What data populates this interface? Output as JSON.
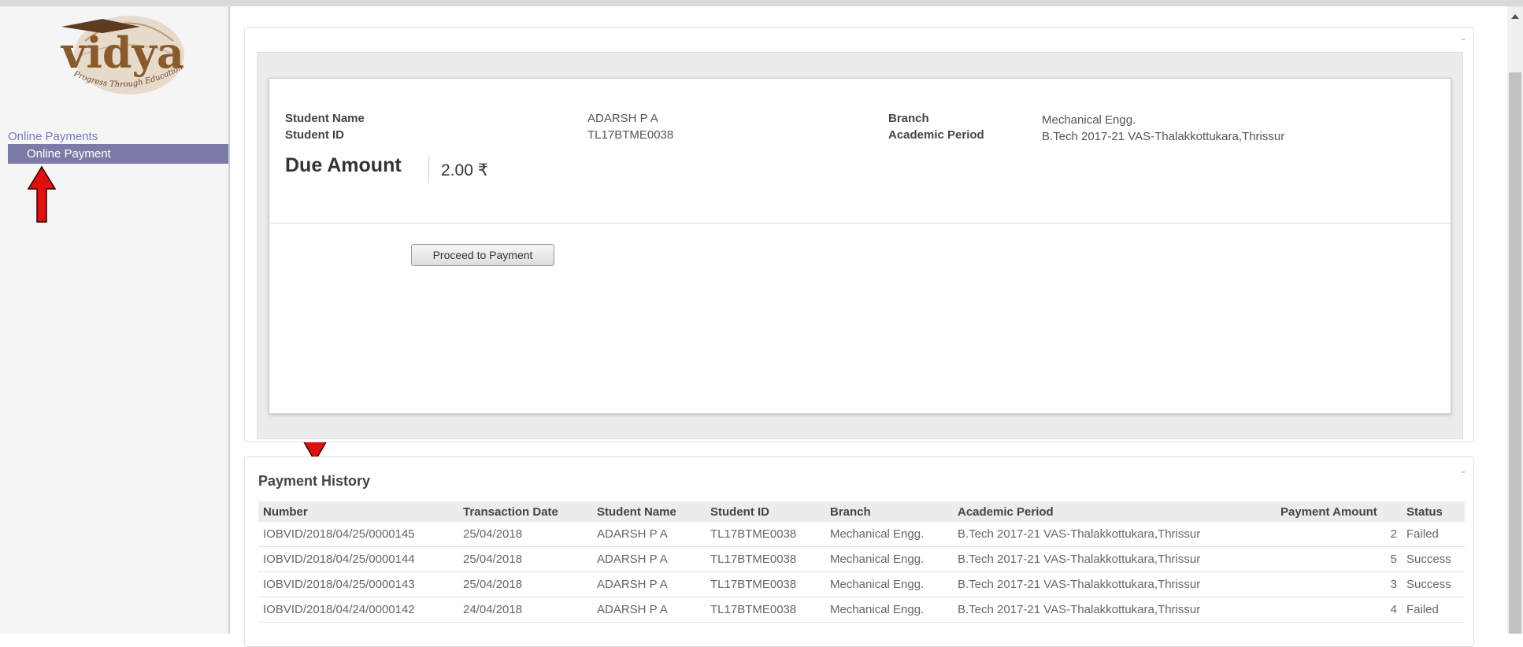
{
  "sidebar": {
    "logo_text": "vidya",
    "logo_tagline": "Progress Through Education",
    "menu_title": "Online Payments",
    "menu_item": "Online Payment"
  },
  "payment_card": {
    "labels": {
      "student_name": "Student Name",
      "student_id": "Student ID",
      "branch": "Branch",
      "academic_period": "Academic Period",
      "due_amount": "Due Amount"
    },
    "values": {
      "student_name": "ADARSH P A",
      "student_id": "TL17BTME0038",
      "branch": "Mechanical Engg.",
      "academic_period": "B.Tech 2017-21 VAS-Thalakkottukara,Thrissur",
      "due_amount": "2.00 ₹"
    },
    "proceed_button": "Proceed to Payment",
    "collapse_symbol": "-"
  },
  "payment_history": {
    "title": "Payment History",
    "collapse_symbol": "-",
    "columns": [
      "Number",
      "Transaction Date",
      "Student Name",
      "Student ID",
      "Branch",
      "Academic Period",
      "Payment Amount",
      "Status"
    ],
    "rows": [
      [
        "IOBVID/2018/04/25/0000145",
        "25/04/2018",
        "ADARSH P A",
        "TL17BTME0038",
        "Mechanical Engg.",
        "B.Tech 2017-21 VAS-Thalakkottukara,Thrissur",
        "2",
        "Failed"
      ],
      [
        "IOBVID/2018/04/25/0000144",
        "25/04/2018",
        "ADARSH P A",
        "TL17BTME0038",
        "Mechanical Engg.",
        "B.Tech 2017-21 VAS-Thalakkottukara,Thrissur",
        "5",
        "Success"
      ],
      [
        "IOBVID/2018/04/25/0000143",
        "25/04/2018",
        "ADARSH P A",
        "TL17BTME0038",
        "Mechanical Engg.",
        "B.Tech 2017-21 VAS-Thalakkottukara,Thrissur",
        "3",
        "Success"
      ],
      [
        "IOBVID/2018/04/24/0000142",
        "24/04/2018",
        "ADARSH P A",
        "TL17BTME0038",
        "Mechanical Engg.",
        "B.Tech 2017-21 VAS-Thalakkottukara,Thrissur",
        "4",
        "Failed"
      ]
    ]
  },
  "colors": {
    "menu_active_bg": "#7c7ba8",
    "menu_title": "#7a79c3",
    "annotation_arrow": "#e01010",
    "logo_brown": "#8b5a2b"
  }
}
